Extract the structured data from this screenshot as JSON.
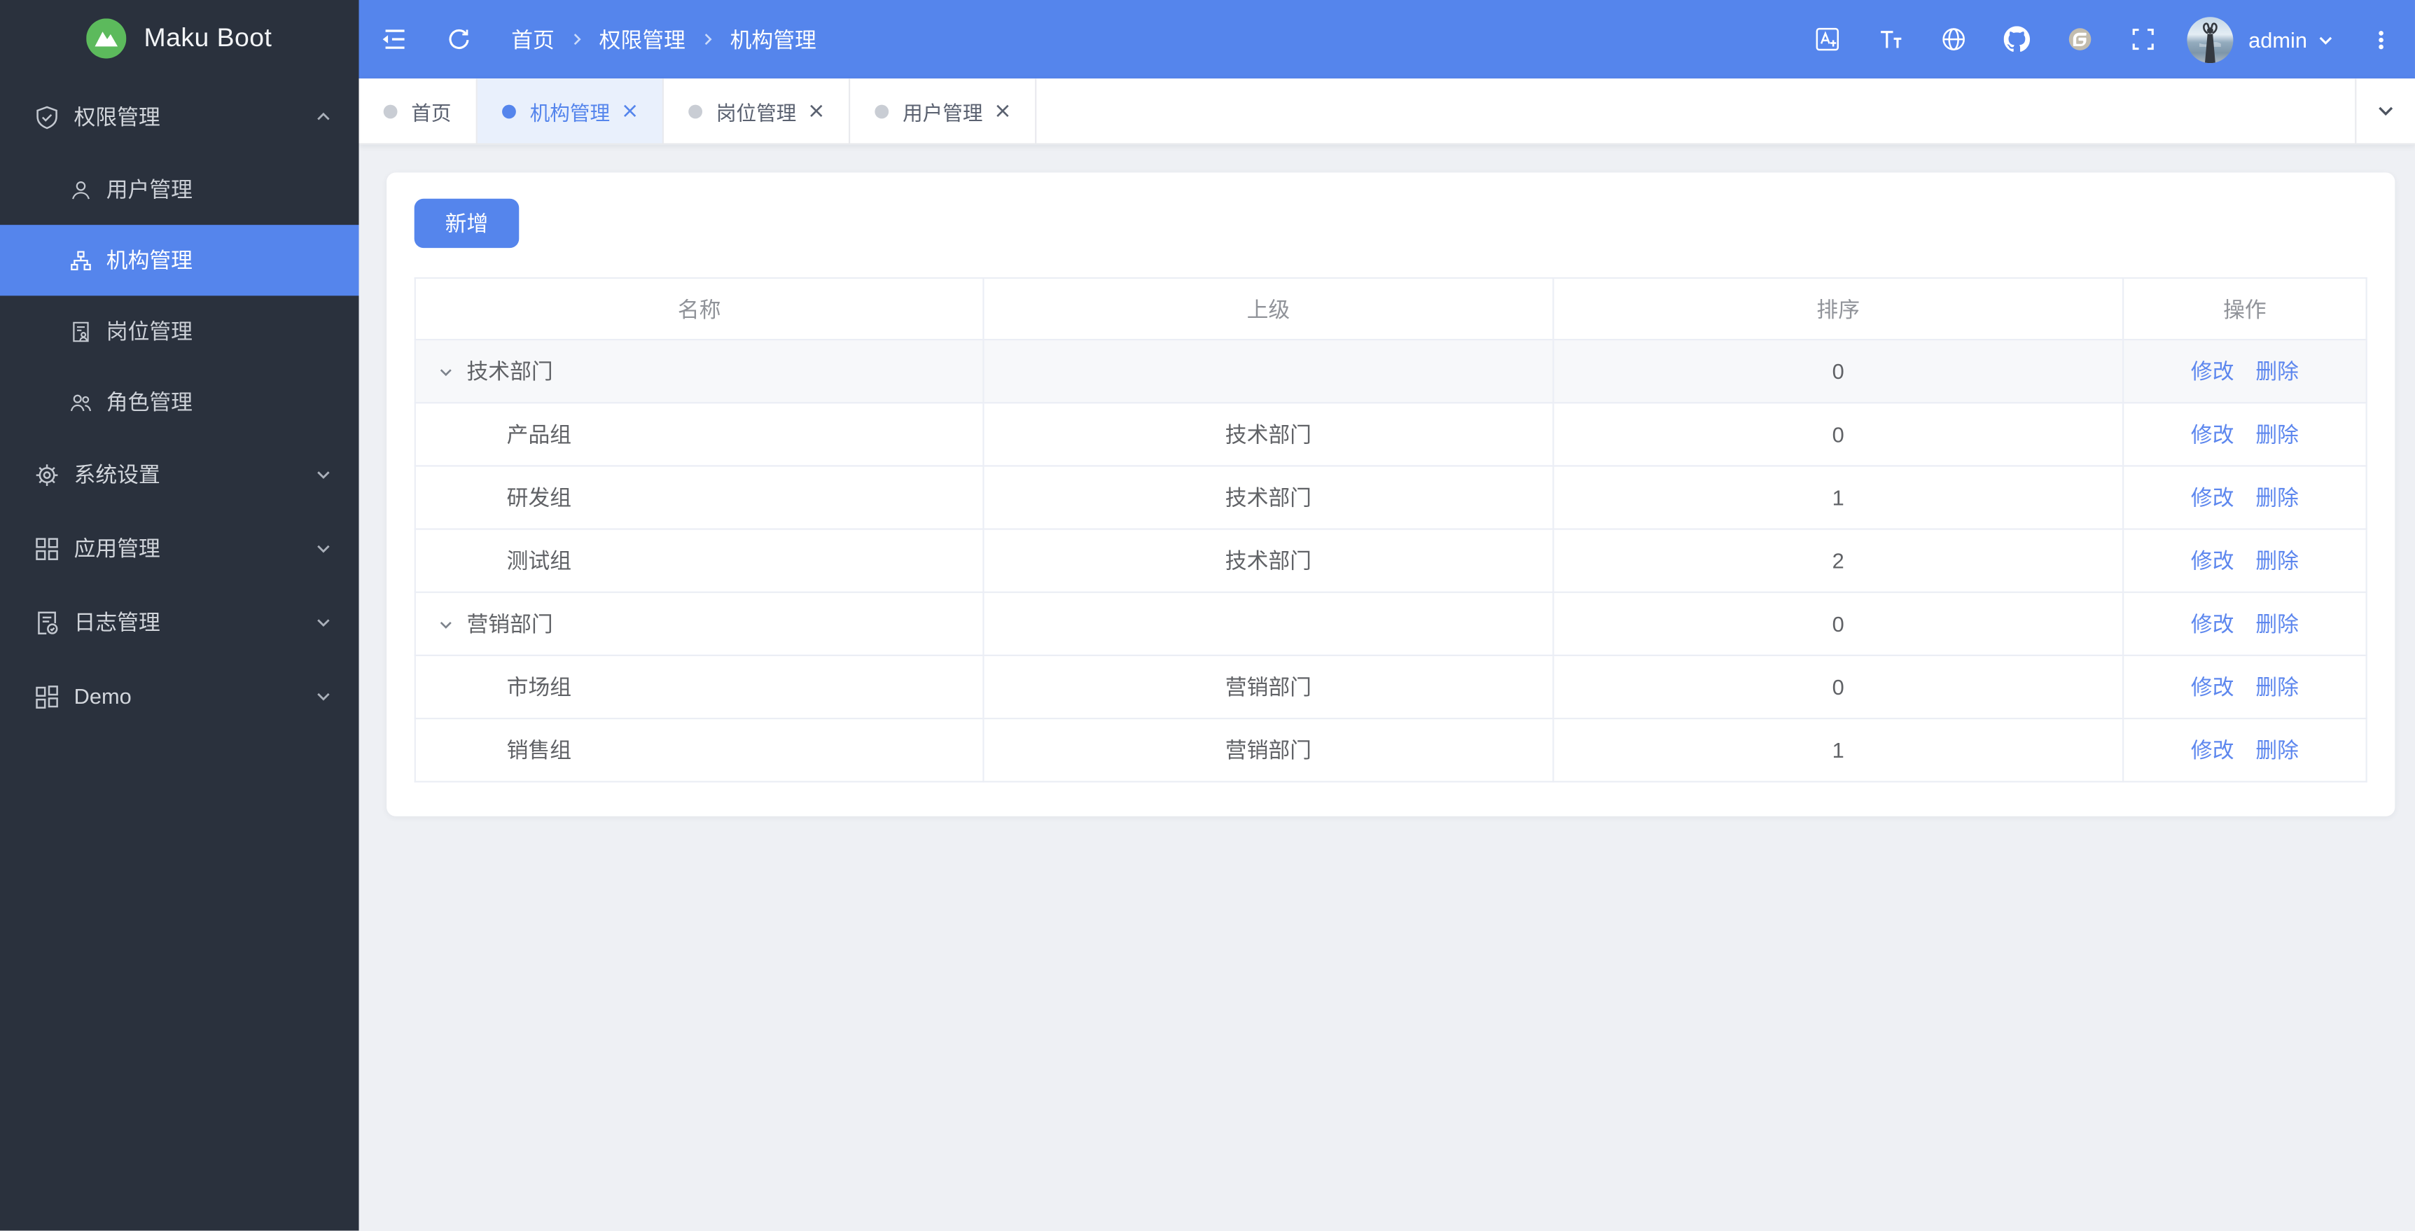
{
  "app": {
    "title": "Maku Boot"
  },
  "colors": {
    "primary_blue": "#5585ec",
    "sidebar_bg": "#2a313d",
    "content_bg": "#eef0f4",
    "logo_green": "#5cba5c",
    "table_border": "#ebeef5",
    "link_blue": "#5d87ee",
    "active_tab_bg": "#e9f0fc"
  },
  "sidebar": {
    "logo_icon": "mountain-logo-icon",
    "logo_text": "Maku Boot",
    "sections": [
      {
        "id": "permission",
        "label": "权限管理",
        "icon": "shield-check-icon",
        "state": "expanded",
        "children": [
          {
            "id": "users",
            "label": "用户管理",
            "icon": "user-icon",
            "active": false
          },
          {
            "id": "orgs",
            "label": "机构管理",
            "icon": "org-tree-icon",
            "active": true
          },
          {
            "id": "posts",
            "label": "岗位管理",
            "icon": "post-doc-icon",
            "active": false
          },
          {
            "id": "roles",
            "label": "角色管理",
            "icon": "roles-icon",
            "active": false
          }
        ]
      },
      {
        "id": "system",
        "label": "系统设置",
        "icon": "gear-icon",
        "state": "collapsed",
        "children": []
      },
      {
        "id": "apps",
        "label": "应用管理",
        "icon": "apps-grid-icon",
        "state": "collapsed",
        "children": []
      },
      {
        "id": "logs",
        "label": "日志管理",
        "icon": "log-doc-icon",
        "state": "collapsed",
        "children": []
      },
      {
        "id": "demo",
        "label": "Demo",
        "icon": "demo-grid-icon",
        "state": "collapsed",
        "children": []
      }
    ]
  },
  "header": {
    "breadcrumb": [
      "首页",
      "权限管理",
      "机构管理"
    ],
    "left_icons": [
      "menu-fold-icon",
      "refresh-icon"
    ],
    "right_icons": [
      "translate-icon",
      "font-size-icon",
      "globe-icon",
      "github-icon",
      "gitee-icon",
      "fullscreen-icon"
    ],
    "user": {
      "name": "admin",
      "avatar": "avatar-photo",
      "menu_icon": "chevron-down-icon"
    },
    "more_icon": "kebab-menu-icon"
  },
  "tabs": {
    "items": [
      {
        "id": "home",
        "label": "首页",
        "active": false,
        "closable": false
      },
      {
        "id": "orgs",
        "label": "机构管理",
        "active": true,
        "closable": true
      },
      {
        "id": "posts",
        "label": "岗位管理",
        "active": false,
        "closable": true
      },
      {
        "id": "users",
        "label": "用户管理",
        "active": false,
        "closable": true
      }
    ],
    "dropdown_icon": "chevron-down-icon"
  },
  "content": {
    "add_button_label": "新增",
    "table": {
      "columns": [
        "名称",
        "上级",
        "排序",
        "操作"
      ],
      "action_labels": [
        "修改",
        "删除"
      ],
      "rows": [
        {
          "name": "技术部门",
          "parent": "",
          "sort": "0",
          "level": 0,
          "expandable": true,
          "expanded": true
        },
        {
          "name": "产品组",
          "parent": "技术部门",
          "sort": "0",
          "level": 1,
          "expandable": false
        },
        {
          "name": "研发组",
          "parent": "技术部门",
          "sort": "1",
          "level": 1,
          "expandable": false
        },
        {
          "name": "测试组",
          "parent": "技术部门",
          "sort": "2",
          "level": 1,
          "expandable": false
        },
        {
          "name": "营销部门",
          "parent": "",
          "sort": "0",
          "level": 0,
          "expandable": true,
          "expanded": true
        },
        {
          "name": "市场组",
          "parent": "营销部门",
          "sort": "0",
          "level": 1,
          "expandable": false
        },
        {
          "name": "销售组",
          "parent": "营销部门",
          "sort": "1",
          "level": 1,
          "expandable": false
        }
      ]
    }
  }
}
